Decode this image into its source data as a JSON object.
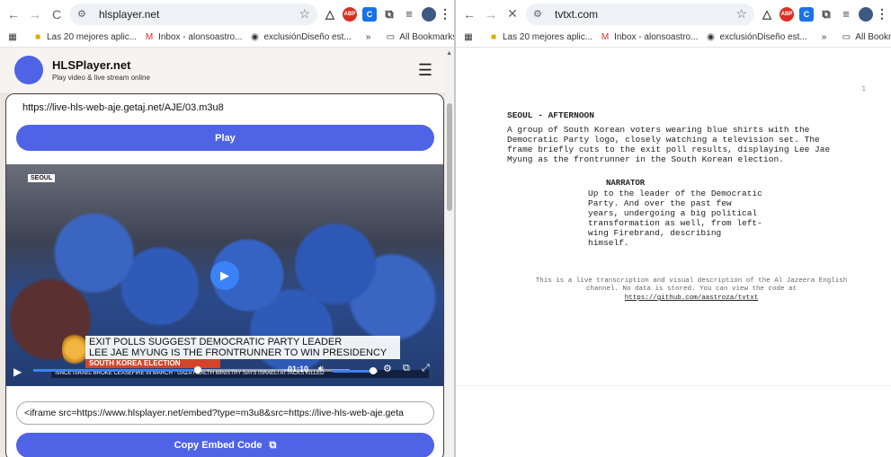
{
  "left": {
    "toolbar": {
      "back": "←",
      "forward": "→",
      "reload": "C",
      "url": "hlsplayer.net"
    },
    "bookmarks": [
      {
        "icon": "grid-icon",
        "label": ""
      },
      {
        "icon": "folder-yellow",
        "label": "Las 20 mejores aplic..."
      },
      {
        "icon": "gmail",
        "label": "Inbox - alonsoastro..."
      },
      {
        "icon": "globe",
        "label": "exclusiónDiseño est..."
      }
    ],
    "bookmarks_overflow": "»",
    "all_bookmarks": "All Bookmarks",
    "site": {
      "title": "HLSPlayer.net",
      "subtitle": "Play video & live stream online",
      "stream_url": "https://live-hls-web-aje.getaj.net/AJE/03.m3u8",
      "play_label": "Play",
      "video": {
        "location_tag": "SEOUL",
        "headline_1": "EXIT POLLS SUGGEST DEMOCRATIC PARTY LEADER",
        "headline_2": "LEE JAE MYUNG IS THE FRONTRUNNER TO WIN PRESIDENCY",
        "strap": "SOUTH KOREA ELECTION",
        "ticker": "SINCE ISRAEL BROKE CEASEFIRE IN MARCH  ·  GAZA HEALTH MINISTRY SAYS ISRAELI ATTACKS KILLED",
        "time": "01:10",
        "progress": 0.52,
        "volume": 0.9
      },
      "embed_code": "<iframe src=https://www.hlsplayer.net/embed?type=m3u8&src=https://live-hls-web-aje.geta",
      "copy_label": "Copy Embed Code"
    }
  },
  "right": {
    "toolbar": {
      "back": "←",
      "forward": "→",
      "stop": "✕",
      "url": "tvtxt.com"
    },
    "bookmarks": [
      {
        "icon": "grid-icon",
        "label": ""
      },
      {
        "icon": "folder-yellow",
        "label": "Las 20 mejores aplic..."
      },
      {
        "icon": "gmail",
        "label": "Inbox - alonsoastro..."
      },
      {
        "icon": "globe",
        "label": "exclusiónDiseño est..."
      }
    ],
    "bookmarks_overflow": "»",
    "all_bookmarks": "All Bookmarks",
    "script": {
      "page_number": "1",
      "scene_heading": "SEOUL - AFTERNOON",
      "action": "A group of South Korean voters wearing blue shirts with the\nDemocratic Party logo, closely watching a television set. The\nframe briefly cuts to the exit poll results, displaying Lee Jae\nMyung as the frontrunner in the South Korean election.",
      "character": "NARRATOR",
      "dialogue": "Up to the leader of the Democratic\nParty. And over the past few\nyears, undergoing a big political\ntransformation as well, from left-\nwing Firebrand, describing\nhimself.",
      "footer": "This is a live transcription and visual description of the Al Jazeera English\nchannel. No data is stored. You can view the code at",
      "footer_link": "https://github.com/aastroza/tvtxt"
    }
  }
}
